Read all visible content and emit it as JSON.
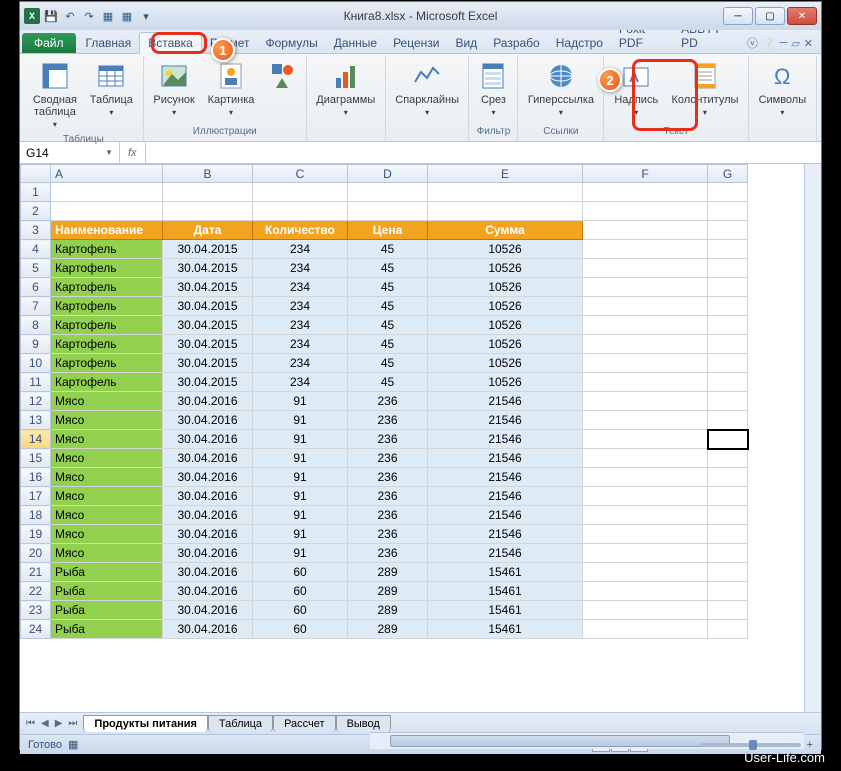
{
  "title": "Книга8.xlsx - Microsoft Excel",
  "qat": [
    "save",
    "undo",
    "redo",
    "q1",
    "q2",
    "q3"
  ],
  "tabs": {
    "file": "Файл",
    "items": [
      "Главная",
      "Вставка",
      "Размет",
      "Формулы",
      "Данные",
      "Рецензи",
      "Вид",
      "Разрабо",
      "Надстро",
      "Foxit PDF",
      "ABBYY PD"
    ],
    "active_index": 1
  },
  "ribbon": {
    "groups": [
      {
        "label": "Таблицы",
        "items": [
          {
            "label": "Сводная\nтаблица",
            "icon": "pivot"
          },
          {
            "label": "Таблица",
            "icon": "table"
          }
        ]
      },
      {
        "label": "Иллюстрации",
        "items": [
          {
            "label": "Рисунок",
            "icon": "picture"
          },
          {
            "label": "Картинка",
            "icon": "clipart"
          },
          {
            "label": "",
            "icon": "shapes-stack"
          }
        ]
      },
      {
        "label": "",
        "items": [
          {
            "label": "Диаграммы",
            "icon": "chart"
          }
        ]
      },
      {
        "label": "",
        "items": [
          {
            "label": "Спарклайны",
            "icon": "sparkline"
          }
        ]
      },
      {
        "label": "Фильтр",
        "items": [
          {
            "label": "Срез",
            "icon": "slicer"
          }
        ]
      },
      {
        "label": "Ссылки",
        "items": [
          {
            "label": "Гиперссылка",
            "icon": "hyperlink"
          }
        ]
      },
      {
        "label": "Текст",
        "items": [
          {
            "label": "Надпись",
            "icon": "textbox"
          },
          {
            "label": "Колонтитулы",
            "icon": "headerfooter"
          }
        ]
      },
      {
        "label": "",
        "items": [
          {
            "label": "Символы",
            "icon": "symbol"
          }
        ]
      }
    ]
  },
  "callouts": {
    "1": "1",
    "2": "2"
  },
  "namebox": "G14",
  "fx": "fx",
  "columns": [
    "A",
    "B",
    "C",
    "D",
    "E",
    "F",
    "G"
  ],
  "header_row": [
    "Наименование",
    "Дата",
    "Количество",
    "Цена",
    "Сумма"
  ],
  "rows": [
    {
      "n": 4,
      "name": "Картофель",
      "date": "30.04.2015",
      "qty": "234",
      "price": "45",
      "sum": "10526"
    },
    {
      "n": 5,
      "name": "Картофель",
      "date": "30.04.2015",
      "qty": "234",
      "price": "45",
      "sum": "10526"
    },
    {
      "n": 6,
      "name": "Картофель",
      "date": "30.04.2015",
      "qty": "234",
      "price": "45",
      "sum": "10526"
    },
    {
      "n": 7,
      "name": "Картофель",
      "date": "30.04.2015",
      "qty": "234",
      "price": "45",
      "sum": "10526"
    },
    {
      "n": 8,
      "name": "Картофель",
      "date": "30.04.2015",
      "qty": "234",
      "price": "45",
      "sum": "10526"
    },
    {
      "n": 9,
      "name": "Картофель",
      "date": "30.04.2015",
      "qty": "234",
      "price": "45",
      "sum": "10526"
    },
    {
      "n": 10,
      "name": "Картофель",
      "date": "30.04.2015",
      "qty": "234",
      "price": "45",
      "sum": "10526"
    },
    {
      "n": 11,
      "name": "Картофель",
      "date": "30.04.2015",
      "qty": "234",
      "price": "45",
      "sum": "10526"
    },
    {
      "n": 12,
      "name": "Мясо",
      "date": "30.04.2016",
      "qty": "91",
      "price": "236",
      "sum": "21546"
    },
    {
      "n": 13,
      "name": "Мясо",
      "date": "30.04.2016",
      "qty": "91",
      "price": "236",
      "sum": "21546"
    },
    {
      "n": 14,
      "name": "Мясо",
      "date": "30.04.2016",
      "qty": "91",
      "price": "236",
      "sum": "21546"
    },
    {
      "n": 15,
      "name": "Мясо",
      "date": "30.04.2016",
      "qty": "91",
      "price": "236",
      "sum": "21546"
    },
    {
      "n": 16,
      "name": "Мясо",
      "date": "30.04.2016",
      "qty": "91",
      "price": "236",
      "sum": "21546"
    },
    {
      "n": 17,
      "name": "Мясо",
      "date": "30.04.2016",
      "qty": "91",
      "price": "236",
      "sum": "21546"
    },
    {
      "n": 18,
      "name": "Мясо",
      "date": "30.04.2016",
      "qty": "91",
      "price": "236",
      "sum": "21546"
    },
    {
      "n": 19,
      "name": "Мясо",
      "date": "30.04.2016",
      "qty": "91",
      "price": "236",
      "sum": "21546"
    },
    {
      "n": 20,
      "name": "Мясо",
      "date": "30.04.2016",
      "qty": "91",
      "price": "236",
      "sum": "21546"
    },
    {
      "n": 21,
      "name": "Рыба",
      "date": "30.04.2016",
      "qty": "60",
      "price": "289",
      "sum": "15461"
    },
    {
      "n": 22,
      "name": "Рыба",
      "date": "30.04.2016",
      "qty": "60",
      "price": "289",
      "sum": "15461"
    },
    {
      "n": 23,
      "name": "Рыба",
      "date": "30.04.2016",
      "qty": "60",
      "price": "289",
      "sum": "15461"
    },
    {
      "n": 24,
      "name": "Рыба",
      "date": "30.04.2016",
      "qty": "60",
      "price": "289",
      "sum": "15461"
    }
  ],
  "selected_row": 14,
  "sheets": {
    "active": "Продукты питания",
    "others": [
      "Таблица",
      "Рассчет",
      "Вывод"
    ]
  },
  "status": {
    "ready": "Готово",
    "zoom": "100%"
  },
  "watermark": "User-Life.com"
}
